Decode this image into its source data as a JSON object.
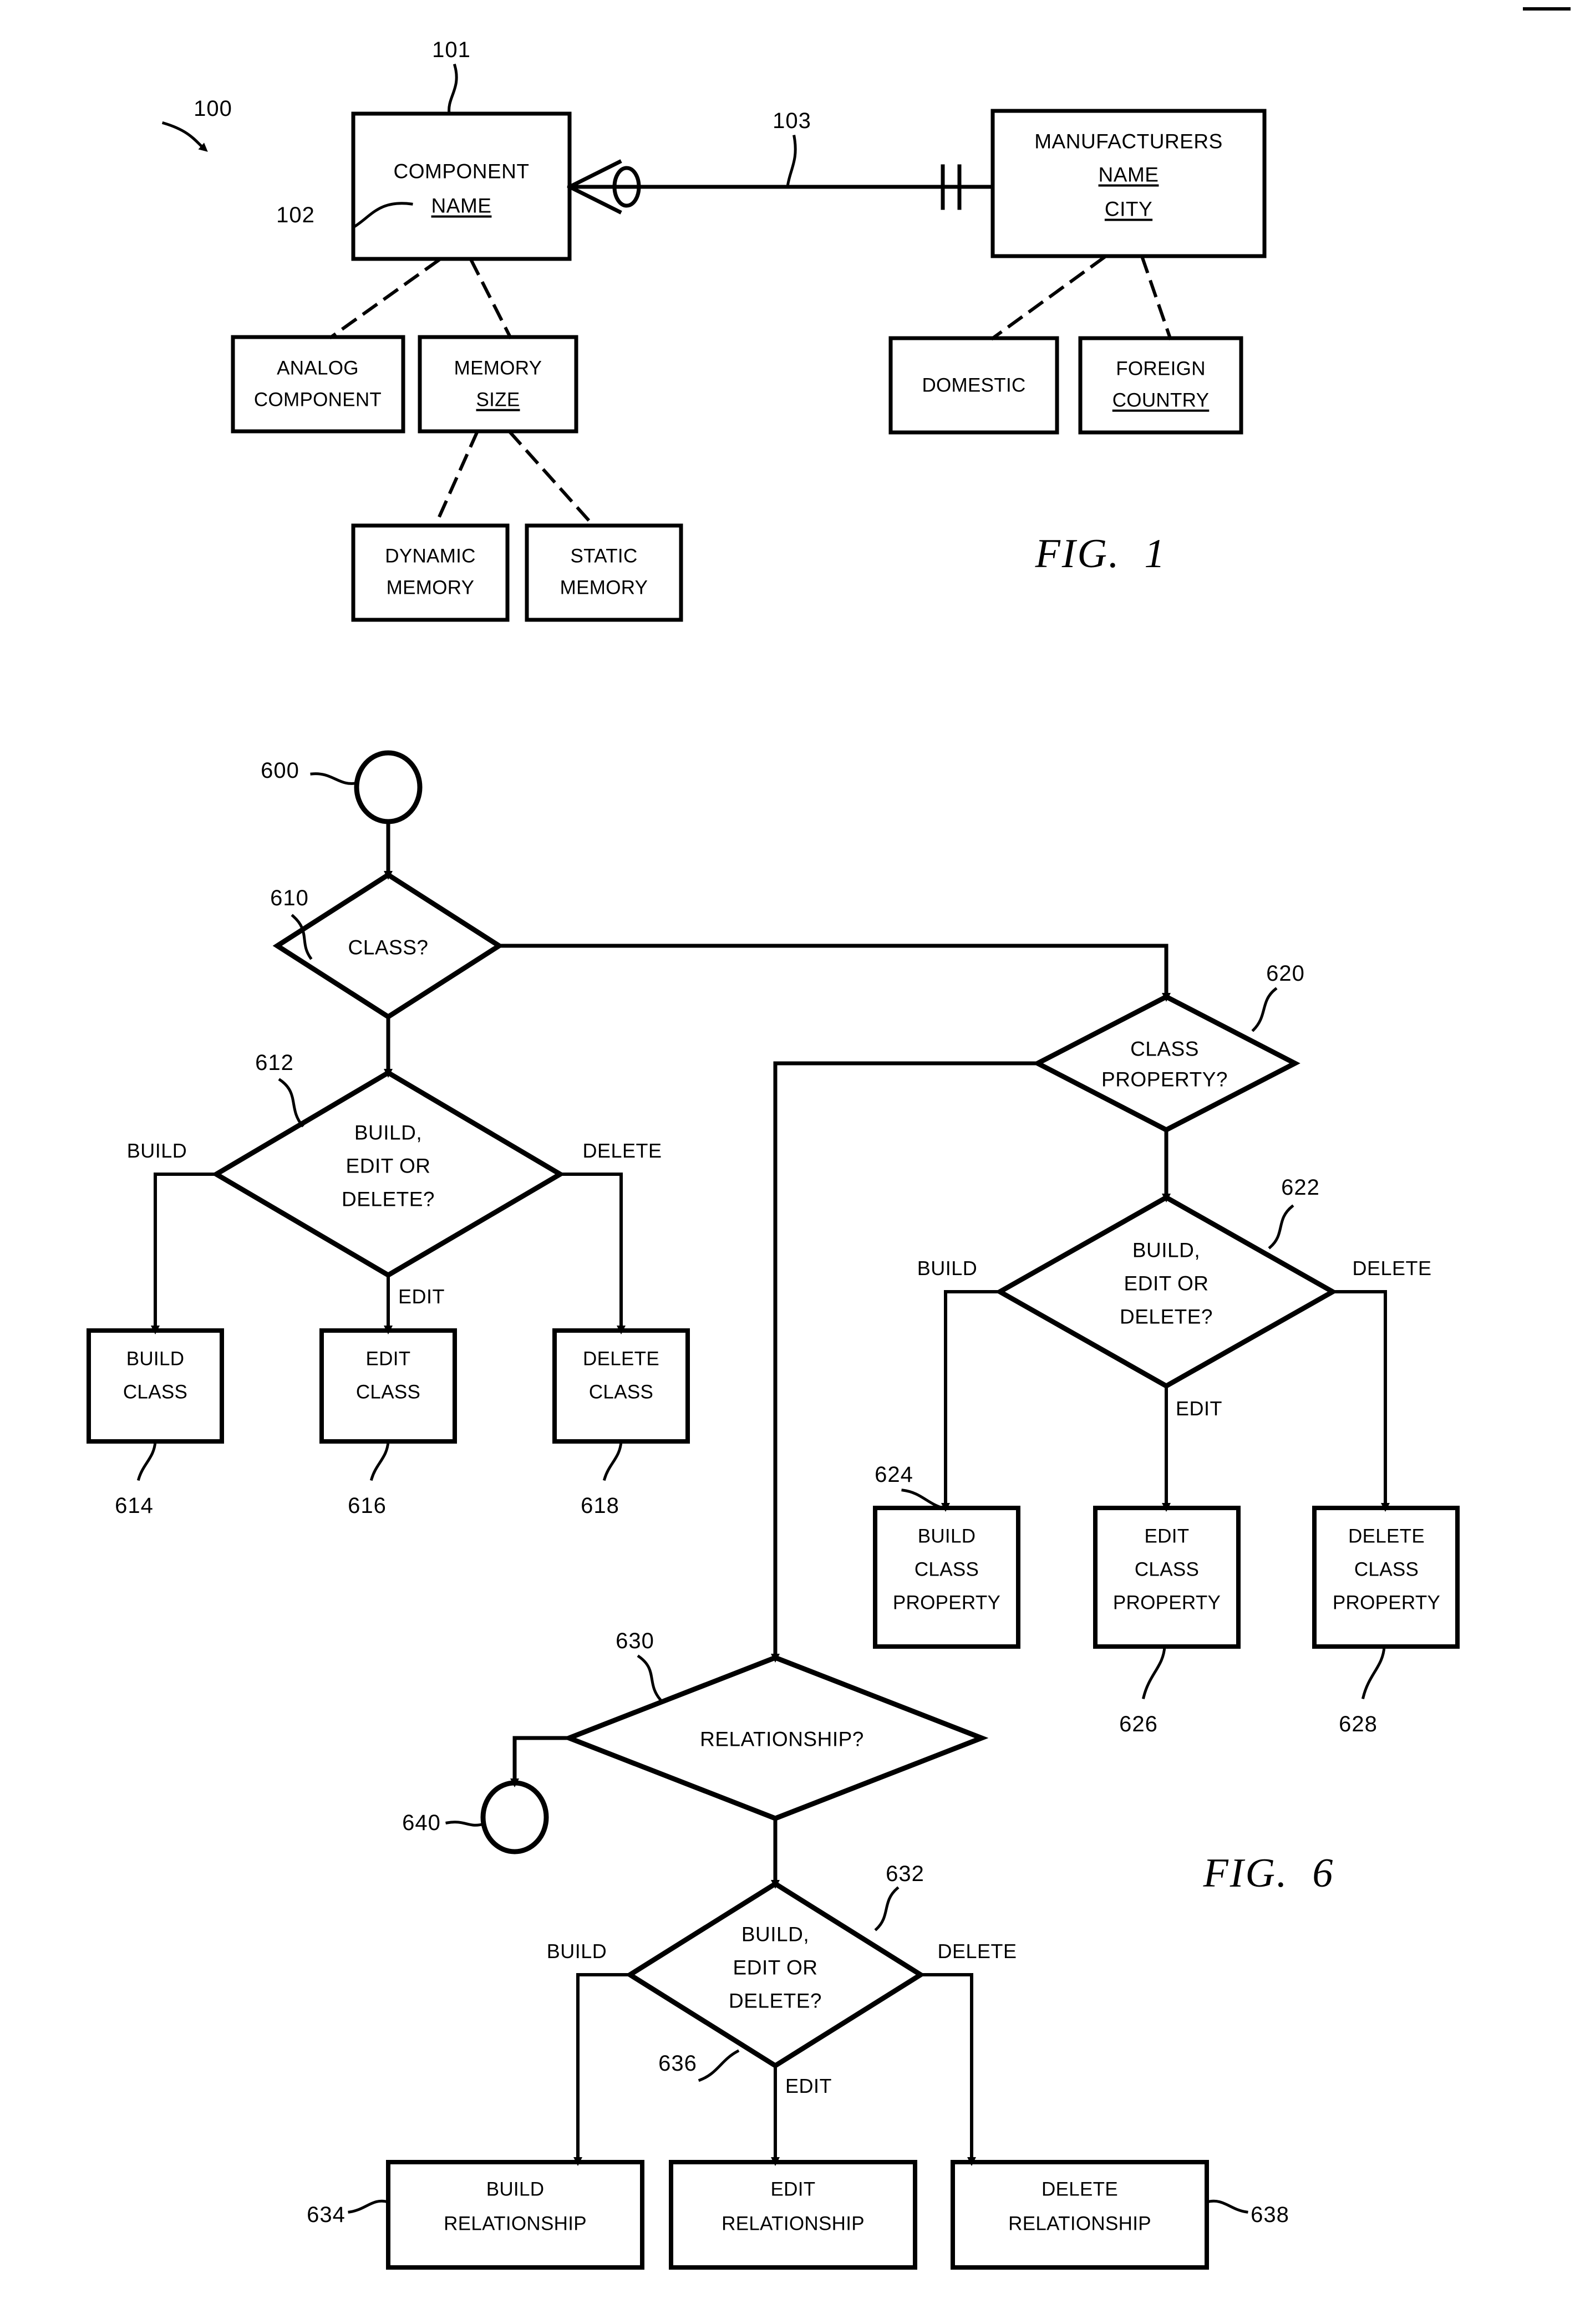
{
  "figures": [
    {
      "id": "fig1",
      "caption": "FIG.  1",
      "ref_label": "100",
      "nodes": {
        "component": {
          "ref": "101",
          "ref2": "102",
          "line1": "COMPONENT",
          "line2": "NAME"
        },
        "manufacturers": {
          "line1": "MANUFACTURERS",
          "line2": "NAME",
          "line3": "CITY"
        },
        "relationship": {
          "ref": "103"
        },
        "analog": {
          "line1": "ANALOG",
          "line2": "COMPONENT"
        },
        "memory": {
          "line1": "MEMORY",
          "line2": "SIZE"
        },
        "dynamic": {
          "line1": "DYNAMIC",
          "line2": "MEMORY"
        },
        "static": {
          "line1": "STATIC",
          "line2": "MEMORY"
        },
        "domestic": {
          "line1": "DOMESTIC"
        },
        "foreign": {
          "line1": "FOREIGN",
          "line2": "COUNTRY"
        }
      }
    },
    {
      "id": "fig6",
      "caption": "FIG.  6",
      "start_ref": "600",
      "connector_ref": "640",
      "decisions": {
        "class": {
          "ref": "610",
          "text": "CLASS?"
        },
        "class_property": {
          "ref": "620",
          "line1": "CLASS",
          "line2": "PROPERTY?"
        },
        "bed_class": {
          "ref": "612",
          "line1": "BUILD,",
          "line2": "EDIT OR",
          "line3": "DELETE?"
        },
        "bed_property": {
          "ref": "622",
          "line1": "BUILD,",
          "line2": "EDIT OR",
          "line3": "DELETE?"
        },
        "relationship": {
          "ref": "630",
          "text": "RELATIONSHIP?"
        },
        "bed_relationship": {
          "ref": "632",
          "line1": "BUILD,",
          "line2": "EDIT OR",
          "line3": "DELETE?"
        }
      },
      "edge_labels": {
        "build": "BUILD",
        "edit": "EDIT",
        "delete": "DELETE"
      },
      "processes": [
        {
          "ref": "614",
          "line1": "BUILD",
          "line2": "CLASS"
        },
        {
          "ref": "616",
          "line1": "EDIT",
          "line2": "CLASS"
        },
        {
          "ref": "618",
          "line1": "DELETE",
          "line2": "CLASS"
        },
        {
          "ref": "624",
          "line1": "BUILD",
          "line2": "CLASS",
          "line3": "PROPERTY"
        },
        {
          "ref": "626",
          "line1": "EDIT",
          "line2": "CLASS",
          "line3": "PROPERTY"
        },
        {
          "ref": "628",
          "line1": "DELETE",
          "line2": "CLASS",
          "line3": "PROPERTY"
        },
        {
          "ref": "634",
          "line1": "BUILD",
          "line2": "RELATIONSHIP"
        },
        {
          "ref": "636",
          "line1": "EDIT",
          "line2": "RELATIONSHIP"
        },
        {
          "ref": "638",
          "line1": "DELETE",
          "line2": "RELATIONSHIP"
        }
      ]
    }
  ],
  "colors": {
    "ink": "#000000",
    "paper": "#ffffff"
  }
}
